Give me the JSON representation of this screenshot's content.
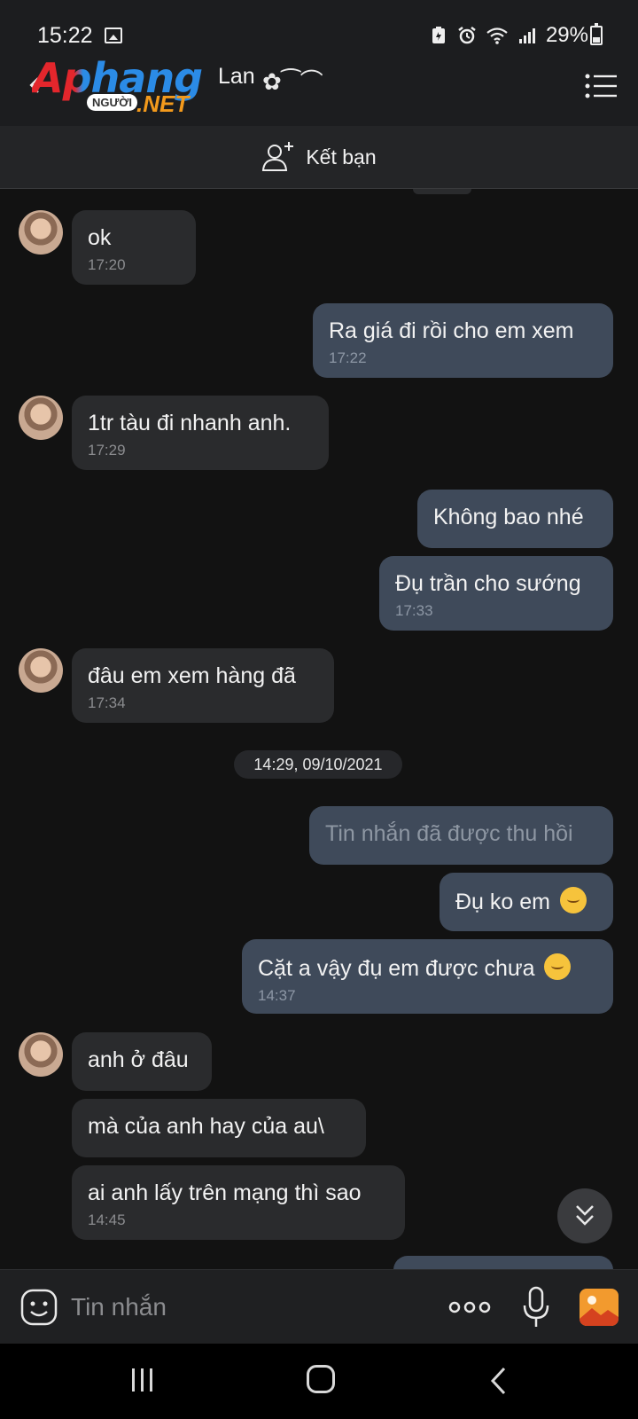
{
  "status_bar": {
    "time": "15:22",
    "battery": "29%"
  },
  "header": {
    "contact_name": "Lan",
    "name_decoration": "✿⁀⌒",
    "watermark": {
      "main": "Aphang",
      "sub": "NGƯỜI",
      "suffix": ".NET"
    }
  },
  "friend_bar": {
    "label": "Kết bạn"
  },
  "messages": [
    {
      "dir": "in",
      "text": "ok",
      "time": "17:20"
    },
    {
      "dir": "out",
      "text": "Ra giá đi rồi cho em xem",
      "time": "17:22"
    },
    {
      "dir": "in",
      "text": "1tr tàu đi nhanh anh.",
      "time": "17:29"
    },
    {
      "dir": "out",
      "text": "Không bao nhé",
      "time": ""
    },
    {
      "dir": "out",
      "text": "Đụ trần cho sướng",
      "time": "17:33"
    },
    {
      "dir": "in",
      "text": "đâu em xem hàng đã",
      "time": "17:34"
    },
    {
      "dir": "out",
      "text": "Tin nhắn đã được thu hồi",
      "time": "",
      "recalled": true
    },
    {
      "dir": "out",
      "text": "Đụ ko em",
      "time": "",
      "emoji": "thinking-face"
    },
    {
      "dir": "out",
      "text": "Cặt a vậy đụ em được chưa",
      "time": "14:37",
      "emoji": "thinking-face"
    },
    {
      "dir": "in",
      "text": "anh ở đâu",
      "time": ""
    },
    {
      "dir": "in",
      "text": "mà của anh hay của au\\",
      "time": ""
    },
    {
      "dir": "in",
      "text": "ai anh lấy trên mạng thì sao",
      "time": "14:45"
    }
  ],
  "date_separator": "14:29, 09/10/2021",
  "input_bar": {
    "placeholder": "Tin nhắn"
  },
  "colors": {
    "background": "#121212",
    "incoming_bubble": "#2a2b2d",
    "outgoing_bubble": "#3f4a5a",
    "image_button": "#f29a2e"
  },
  "icons": [
    "back-arrow-icon",
    "menu-list-icon",
    "add-friend-icon",
    "smiley-icon",
    "more-dots-icon",
    "microphone-icon",
    "image-icon",
    "chevron-double-down-icon"
  ]
}
